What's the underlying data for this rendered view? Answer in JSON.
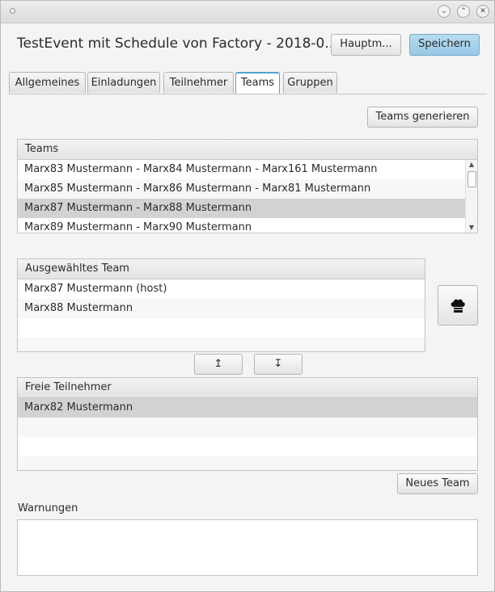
{
  "window": {
    "title": "TestEvent mit Schedule von Factory - 2018-0...",
    "controls": {
      "minimize": "⌄",
      "maximize": "⌃",
      "close": "✕"
    }
  },
  "header": {
    "main_button": "Hauptm...",
    "save_button": "Speichern"
  },
  "tabs": [
    {
      "label": "Allgemeines",
      "active": false
    },
    {
      "label": "Einladungen",
      "active": false
    },
    {
      "label": "Teilnehmer",
      "active": false
    },
    {
      "label": "Teams",
      "active": true
    },
    {
      "label": "Gruppen",
      "active": false
    }
  ],
  "teams_panel": {
    "generate_button": "Teams generieren",
    "header": "Teams",
    "rows": [
      "Marx83 Mustermann - Marx84 Mustermann - Marx161 Mustermann",
      "Marx85 Mustermann - Marx86 Mustermann - Marx81 Mustermann",
      "Marx87 Mustermann - Marx88 Mustermann",
      "Marx89 Mustermann - Marx90 Mustermann"
    ],
    "selected_index": 2
  },
  "selected_team": {
    "header": "Ausgewähltes Team",
    "rows": [
      "Marx87 Mustermann (host)",
      "Marx88 Mustermann"
    ],
    "cook_icon": "chef-hat-icon",
    "move_up": "↥",
    "move_down": "↧"
  },
  "free_participants": {
    "header": "Freie Teilnehmer",
    "rows": [
      "Marx82 Mustermann"
    ],
    "selected_index": 0,
    "new_team_button": "Neues Team"
  },
  "warnings": {
    "label": "Warnungen",
    "text": ""
  },
  "colors": {
    "accent": "#56a0d3",
    "primary_button": "#a8d3ec",
    "selection": "#d2d2d2"
  }
}
